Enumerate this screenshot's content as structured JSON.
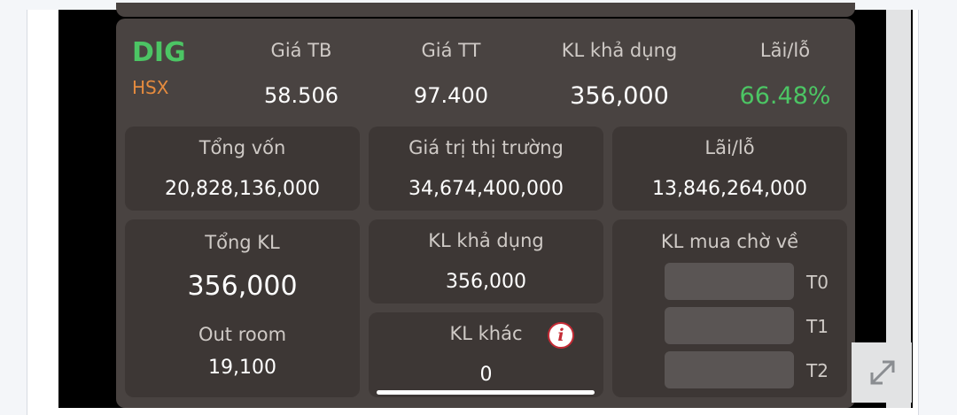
{
  "stock": {
    "symbol": "DIG",
    "exchange": "HSX"
  },
  "summary": {
    "avg_price_label": "Giá TB",
    "avg_price": "58.506",
    "market_price_label": "Giá TT",
    "market_price": "97.400",
    "available_qty_label": "KL khả dụng",
    "available_qty": "356,000",
    "pl_label": "Lãi/lỗ",
    "pl_percent": "66.48%"
  },
  "panels": {
    "total_capital_label": "Tổng vốn",
    "total_capital": "20,828,136,000",
    "market_value_label": "Giá trị thị trường",
    "market_value": "34,674,400,000",
    "pl_label": "Lãi/lỗ",
    "pl_value": "13,846,264,000",
    "total_qty_label": "Tổng KL",
    "total_qty": "356,000",
    "out_room_label": "Out room",
    "out_room": "19,100",
    "available_qty_label": "KL khả dụng",
    "available_qty": "356,000",
    "other_qty_label": "KL khác",
    "other_qty": "0",
    "pending_buy_label": "KL mua chờ về",
    "t0_label": "T0",
    "t1_label": "T1",
    "t2_label": "T2"
  },
  "colors": {
    "positive": "#4cc564",
    "exchange": "#e58b3e",
    "card": "#494341",
    "panel": "#3d3735"
  },
  "icons": {
    "info": "info-icon",
    "expand": "expand-icon"
  }
}
